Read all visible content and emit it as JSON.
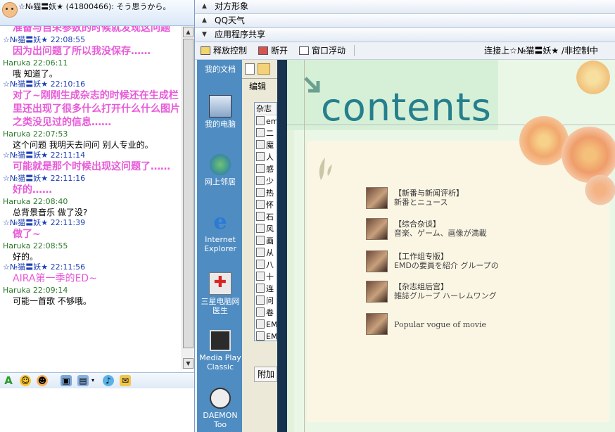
{
  "chat": {
    "header_title": "☆№猫〓妖★ (41800466): そう思うから。",
    "messages": [
      {
        "who": "self",
        "head": "",
        "body": "准备与自荣参数的时候就发现这问题"
      },
      {
        "who": "self",
        "head": "☆№猫〓妖★ 22:08:55",
        "body": "因为出问题了所以我没保存……"
      },
      {
        "who": "peer",
        "head": "Haruka 22:06:11",
        "body": "哦  知道了。"
      },
      {
        "who": "self",
        "head": "☆№猫〓妖★ 22:10:16",
        "body": "对了~刚刚生成杂志的时候还在生成栏里还出现了很多什么打开什么什么图片之类没见过的信息……"
      },
      {
        "who": "peer",
        "head": "Haruka 22:07:53",
        "body": "这个问题  我明天去问问 别人专业的。"
      },
      {
        "who": "self",
        "head": "☆№猫〓妖★ 22:11:14",
        "body": "可能就是那个时候出现这问题了……"
      },
      {
        "who": "self",
        "head": "☆№猫〓妖★ 22:11:16",
        "body": "好的……"
      },
      {
        "who": "peer",
        "head": "Haruka 22:08:40",
        "body": "总背景音乐  做了没?"
      },
      {
        "who": "self",
        "head": "☆№猫〓妖★ 22:11:39",
        "body": "做了~"
      },
      {
        "who": "peer",
        "head": "Haruka 22:08:55",
        "body": "好的。"
      },
      {
        "who": "self",
        "head": "☆№猫〓妖★ 22:11:56",
        "body": "AIRA第一季的ED~"
      },
      {
        "who": "peer",
        "head": "Haruka 22:09:14",
        "body": "可能一首歌  不够哦。"
      }
    ]
  },
  "panels": {
    "acc1": "对方形象",
    "acc2": "QQ天气",
    "acc3": "应用程序共享"
  },
  "share": {
    "release": "释放控制",
    "disconnect": "断开",
    "float": "窗口浮动",
    "status": "连接上☆№猫〓妖★ /非控制中"
  },
  "desktop": {
    "icons": [
      "我的文档",
      "我的电脑",
      "网上邻居",
      "Internet Explorer",
      "三星电脑网医生",
      "Media Play Classic",
      "DAEMON Too"
    ]
  },
  "explorer": {
    "tab": "编辑",
    "items": [
      "杂志",
      "em",
      "二",
      "魔",
      "人",
      "感",
      "少",
      "热",
      "怀",
      "石",
      "风",
      "画",
      "从",
      "八",
      "十",
      "连",
      "问",
      "卷",
      "EMI",
      "EMI"
    ],
    "footer": "附加"
  },
  "magazine": {
    "title": "contents",
    "entries": [
      {
        "t1": "【新番与新闻评析】",
        "t2": "新番とニュース"
      },
      {
        "t1": "【综合杂谈】",
        "t2": "音楽、ゲーム、画像が満載"
      },
      {
        "t1": "【工作组专版】",
        "t2": "EMDの要員を紹介  グループの"
      },
      {
        "t1": "【杂志组后宫】",
        "t2": "雑誌グループ  ハーレムワング"
      },
      {
        "t1": "",
        "t2": "Popular vogue of movie"
      }
    ]
  },
  "colors": {
    "self_msg": "#e85ad8",
    "title_teal": "#267f8c",
    "desktop_blue": "#3c7bb0"
  }
}
